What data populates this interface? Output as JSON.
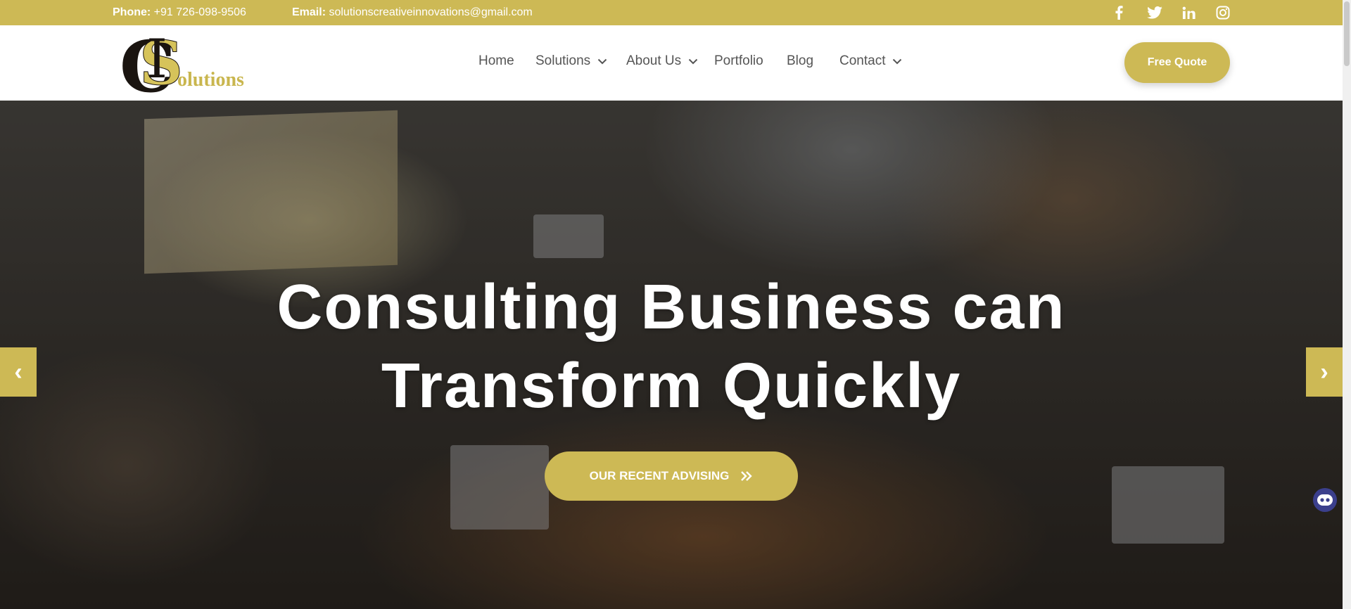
{
  "topbar": {
    "phone_label": "Phone:",
    "phone_value": "+91 726-098-9506",
    "email_label": "Email:",
    "email_value": "solutionscreativeinnovations@gmail.com",
    "social_icons": [
      "facebook-icon",
      "twitter-icon",
      "linkedin-icon",
      "instagram-icon"
    ]
  },
  "header": {
    "logo_text": "olutions",
    "nav": {
      "home": "Home",
      "solutions": "Solutions",
      "about": "About Us",
      "portfolio": "Portfolio",
      "blog": "Blog",
      "contact": "Contact"
    },
    "cta_label": "Free Quote"
  },
  "hero": {
    "title_line1": "Consulting Business can",
    "title_line2": "Transform Quickly",
    "cta_label": "OUR RECENT ADVISING",
    "prev_arrow": "‹",
    "next_arrow": "›"
  },
  "colors": {
    "accent": "#cdb955",
    "nav_text": "#555555",
    "chat_widget": "#3b3f8c"
  }
}
